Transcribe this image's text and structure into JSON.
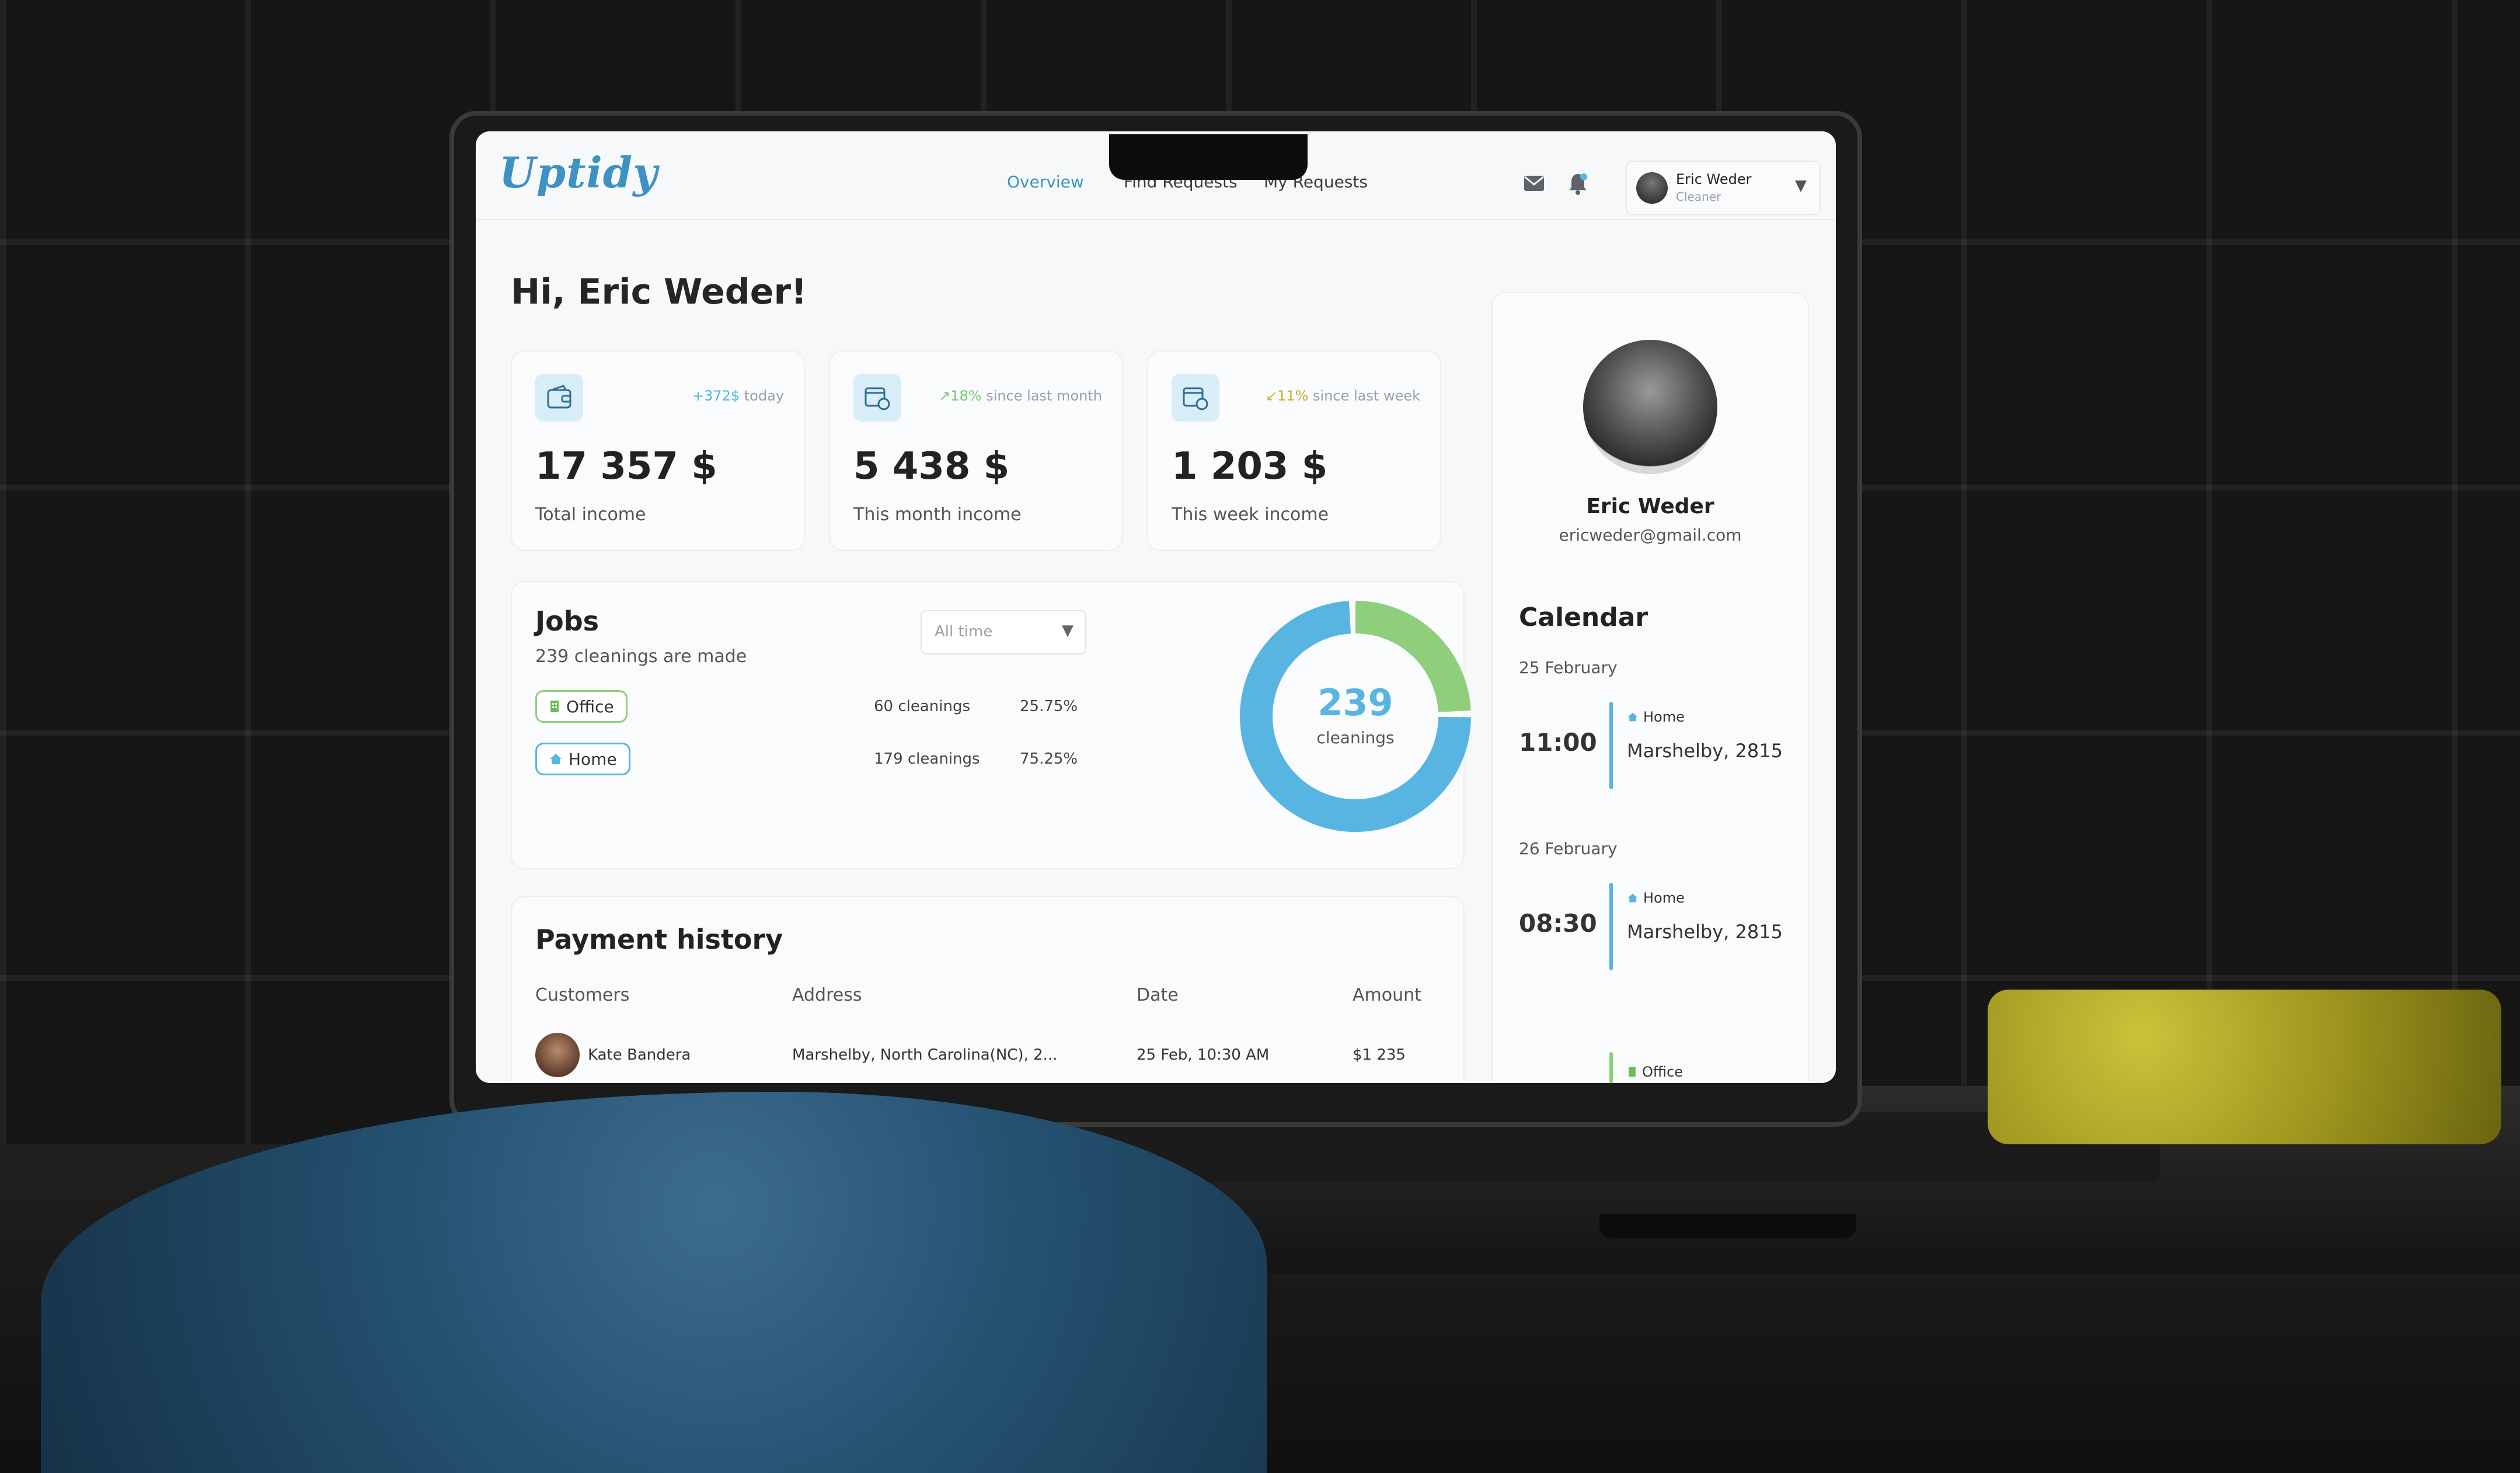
{
  "app": {
    "logo": "Uptidy"
  },
  "nav": {
    "overview": "Overview",
    "find_requests": "Find Requests",
    "my_requests": "My Requests"
  },
  "user": {
    "name": "Eric Weder",
    "role": "Cleaner",
    "email": "ericweder@gmail.com"
  },
  "greeting": "Hi, Eric Weder!",
  "stats": [
    {
      "delta_value": "+372$",
      "delta_text": "today",
      "value": "17 357 $",
      "label": "Total income"
    },
    {
      "delta_value": "↗18%",
      "delta_text": "since last month",
      "value": "5 438 $",
      "label": "This month income"
    },
    {
      "delta_value": "↙11%",
      "delta_text": "since last week",
      "value": "1 203 $",
      "label": "This week income"
    }
  ],
  "jobs": {
    "title": "Jobs",
    "subtitle": "239 cleanings are made",
    "filter": "All time",
    "categories": [
      {
        "label": "Office",
        "count": "60 cleanings",
        "percent": "25.75%"
      },
      {
        "label": "Home",
        "count": "179 cleanings",
        "percent": "75.25%"
      }
    ],
    "total": "239",
    "total_label": "cleanings"
  },
  "chart_data": {
    "type": "pie",
    "categories": [
      "Office",
      "Home"
    ],
    "values": [
      60,
      179
    ],
    "colors": [
      "#8fcf7c",
      "#58b5e1"
    ]
  },
  "payment": {
    "title": "Payment history",
    "columns": [
      "Customers",
      "Address",
      "Date",
      "Amount"
    ],
    "rows": [
      {
        "customer": "Kate Bandera",
        "address": "Marshelby, North Carolina(NC), 2...",
        "date": "25 Feb, 10:30 AM",
        "amount": "$1 235"
      }
    ]
  },
  "calendar": {
    "title": "Calendar",
    "days": [
      {
        "date": "25 February",
        "time": "11:00",
        "type": "Home",
        "place": "Marshelby, 2815"
      },
      {
        "date": "26 February",
        "time": "08:30",
        "type": "Home",
        "place": "Marshelby, 2815"
      }
    ],
    "next_type": "Office"
  },
  "colors": {
    "accent": "#58b5e1",
    "green": "#8fcf7c",
    "brand": "#3d92c3"
  }
}
